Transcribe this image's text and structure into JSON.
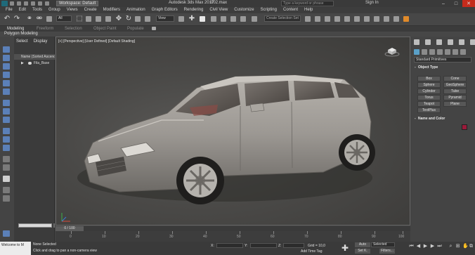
{
  "titlebar": {
    "workspace": "Workspace: Default",
    "app_title": "Autodesk 3ds Max 2017",
    "file_name": "002.max",
    "search_placeholder": "Type a keyword or phrase",
    "sign_in": "Sign In"
  },
  "menubar": [
    "File",
    "Edit",
    "Tools",
    "Group",
    "Views",
    "Create",
    "Modifiers",
    "Animation",
    "Graph Editors",
    "Rendering",
    "Civil View",
    "Customize",
    "Scripting",
    "Content",
    "Help"
  ],
  "toolbar": {
    "selection_filter": "All",
    "reference_coord": "View",
    "named_selection": "Create Selection Set"
  },
  "ribbon": {
    "tabs": [
      "Modeling",
      "Freeform",
      "Selection",
      "Object Paint",
      "Populate"
    ],
    "active_tab": "Modeling",
    "sub_label": "Polygon Modeling"
  },
  "scene_explorer": {
    "tabs": [
      "Select",
      "Display"
    ],
    "column_header": "Name (Sorted Ascending)",
    "items": [
      {
        "name": "Fila_Base"
      }
    ]
  },
  "viewport": {
    "label": "[+] [Perspective] [User Defined] [Default Shading]"
  },
  "command_panel": {
    "category": "Standard Primitives",
    "object_type_header": "Object Type",
    "buttons": [
      "Box",
      "Cone",
      "Sphere",
      "GeoSphere",
      "Cylinder",
      "Tube",
      "Torus",
      "Pyramid",
      "Teapot",
      "Plane",
      "TextPlus"
    ],
    "name_color_header": "Name and Color",
    "color": "#9b1a3a"
  },
  "timeline": {
    "slider_label": "0 / 100",
    "ticks": [
      "0",
      "10",
      "20",
      "30",
      "40",
      "50",
      "60",
      "70",
      "80",
      "90",
      "100"
    ]
  },
  "statusbar": {
    "maxscript": "Welcome to M",
    "selection": "None Selected",
    "prompt": "Click and drag to pan a non-camera view",
    "x_label": "X:",
    "y_label": "Y:",
    "z_label": "Z:",
    "grid": "Grid = 10,0",
    "add_time_tag": "Add Time Tag",
    "auto": "Auto",
    "set_key": "Set K.",
    "selected": "Selected",
    "filters": "Filters..."
  }
}
